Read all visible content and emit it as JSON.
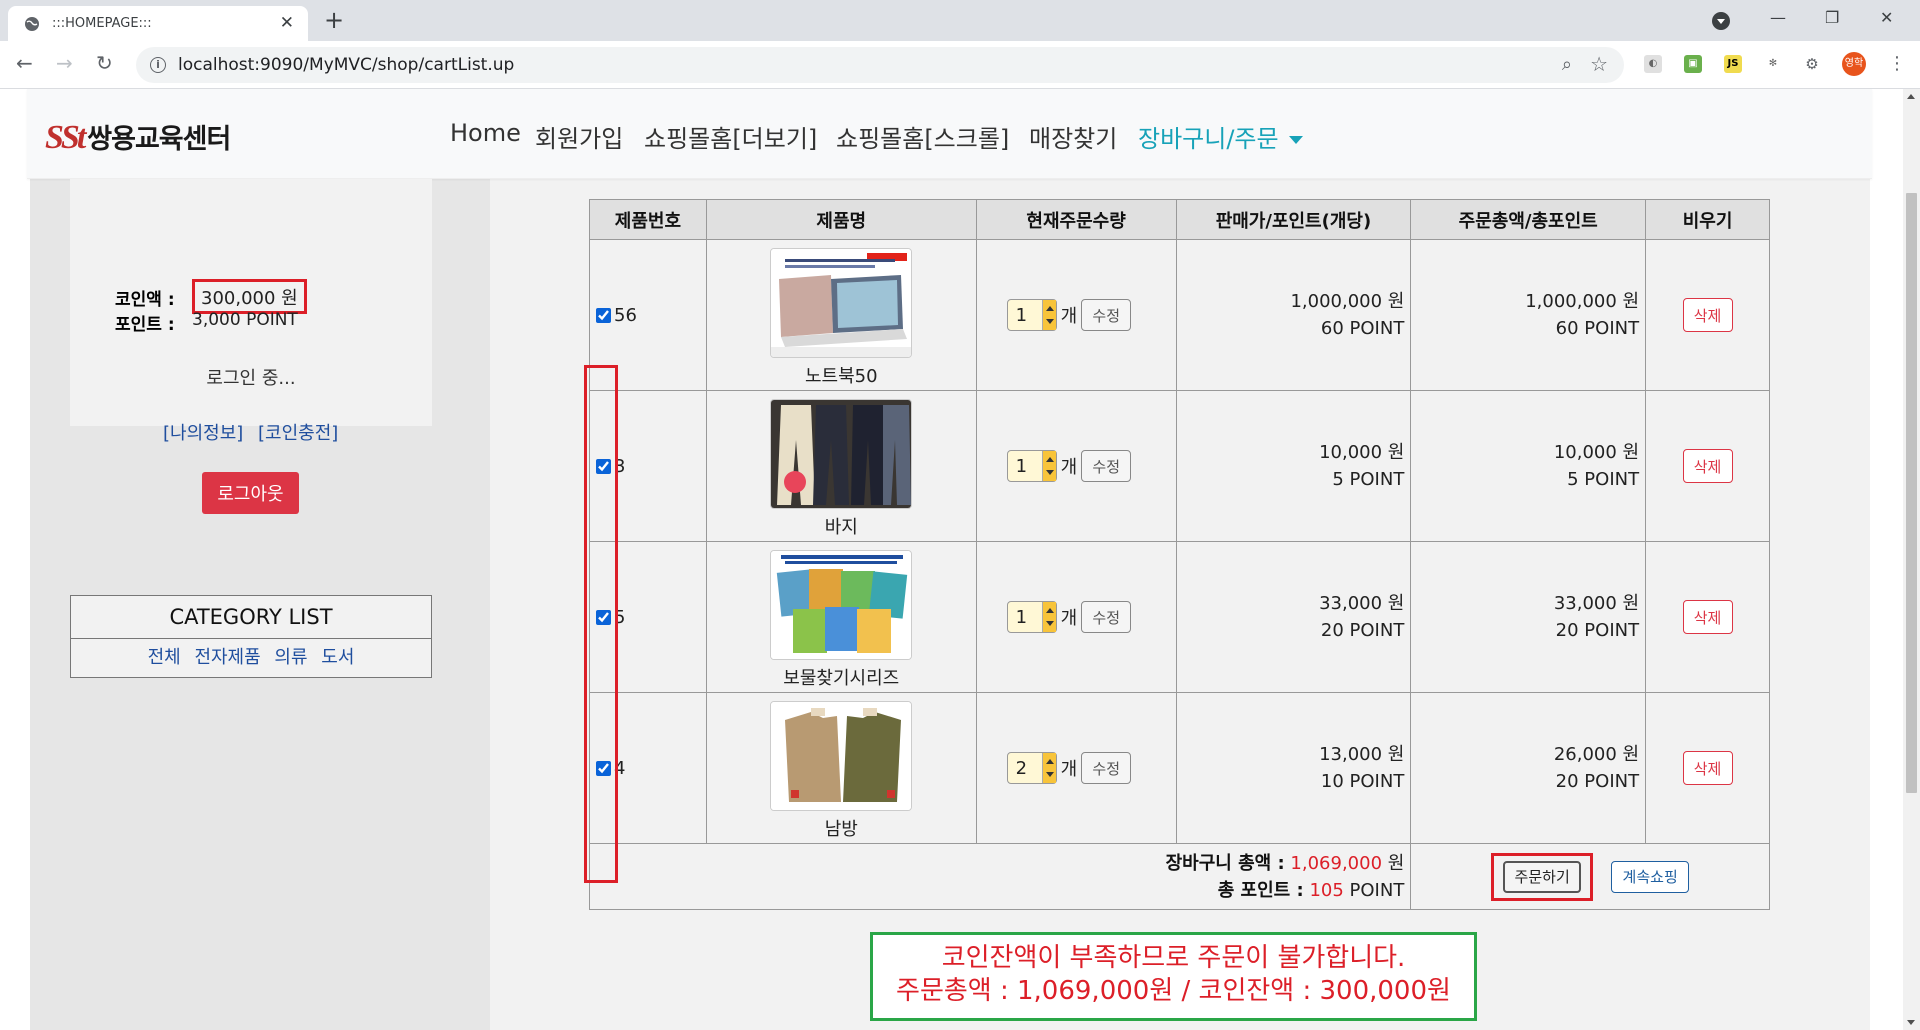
{
  "browser": {
    "tab_title": ":::HOMEPAGE:::",
    "url": "localhost:9090/MyMVC/shop/cartList.up",
    "profile_label": "영학"
  },
  "navbar": {
    "logo_mark": "SSt",
    "logo_text": "쌍용교육센터",
    "links": [
      "Home",
      "회원가입",
      "쇼핑몰홈[더보기]",
      "쇼핑몰홈[스크롤]",
      "매장찾기"
    ],
    "active_link": "장바구니/주문"
  },
  "sidebar": {
    "coin_label": "코인액 :",
    "coin_value": "300,000 원",
    "point_label": "포인트 :",
    "point_value": "3,000 POINT",
    "logged_in": "로그인 중...",
    "my_info": "[나의정보]",
    "coin_charge": "[코인충전]",
    "logout": "로그아웃",
    "category_title": "CATEGORY LIST",
    "categories": [
      "전체",
      "전자제품",
      "의류",
      "도서"
    ]
  },
  "cart": {
    "headers": [
      "제품번호",
      "제품명",
      "현재주문수량",
      "판매가/포인트(개당)",
      "주문총액/총포인트",
      "비우기"
    ],
    "unit_label": "개",
    "edit_label": "수정",
    "delete_label": "삭제",
    "rows": [
      {
        "no": "56",
        "name": "노트북50",
        "qty": "1",
        "price": "1,000,000 원",
        "point": "60 POINT",
        "total": "1,000,000 원",
        "total_point": "60 POINT",
        "checked": true
      },
      {
        "no": "3",
        "name": "바지",
        "qty": "1",
        "price": "10,000 원",
        "point": "5 POINT",
        "total": "10,000 원",
        "total_point": "5 POINT",
        "checked": true
      },
      {
        "no": "5",
        "name": "보물찾기시리즈",
        "qty": "1",
        "price": "33,000 원",
        "point": "20 POINT",
        "total": "33,000 원",
        "total_point": "20 POINT",
        "checked": true
      },
      {
        "no": "4",
        "name": "남방",
        "qty": "2",
        "price": "13,000 원",
        "point": "10 POINT",
        "total": "26,000 원",
        "total_point": "20 POINT",
        "checked": true
      }
    ],
    "sum_label": "장바구니 총액 :",
    "sum_value": "1,069,000",
    "sum_unit": "원",
    "point_label": "총 포인트 :",
    "point_value": "105",
    "point_unit": "POINT",
    "order_button": "주문하기",
    "continue_button": "계속쇼핑"
  },
  "message": {
    "line1": "코인잔액이 부족하므로 주문이 불가합니다.",
    "line2": "주문총액 : 1,069,000원 / 코인잔액 : 300,000원"
  },
  "colors": {
    "accent": "#17a2b8",
    "danger": "#dc3545",
    "highlight_red": "#dc1f28",
    "highlight_green": "#2aa647"
  }
}
